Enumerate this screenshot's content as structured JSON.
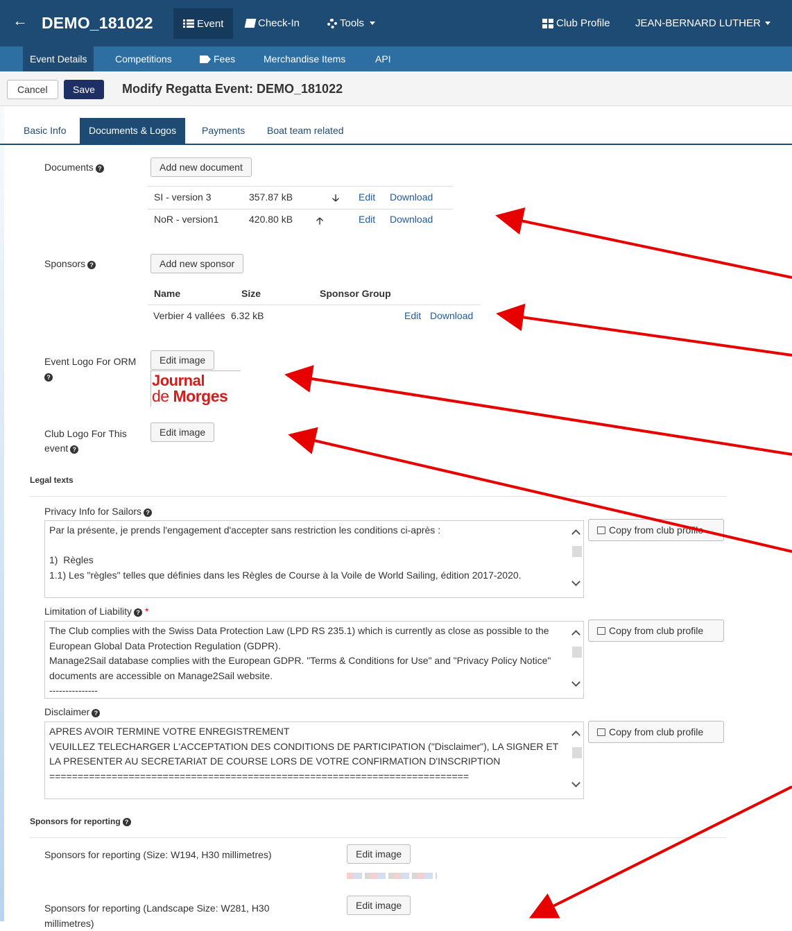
{
  "topbar": {
    "title": "DEMO_181022",
    "nav": {
      "event": "Event",
      "checkin": "Check-In",
      "tools": "Tools",
      "club_profile": "Club Profile",
      "user": "JEAN-BERNARD LUTHER"
    }
  },
  "subnav": {
    "event_details": "Event Details",
    "competitions": "Competitions",
    "fees": "Fees",
    "merchandise": "Merchandise Items",
    "api": "API"
  },
  "actions": {
    "cancel": "Cancel",
    "save": "Save",
    "page_title": "Modify Regatta Event: DEMO_181022"
  },
  "tabs": {
    "basic": "Basic Info",
    "documents": "Documents & Logos",
    "payments": "Payments",
    "boat": "Boat team related"
  },
  "documents": {
    "label": "Documents",
    "add_button": "Add new document",
    "rows": [
      {
        "name": "SI - version 3",
        "size": "357.87 kB",
        "edit": "Edit",
        "download": "Download"
      },
      {
        "name": "NoR - version1",
        "size": "420.80 kB",
        "edit": "Edit",
        "download": "Download"
      }
    ]
  },
  "sponsors": {
    "label": "Sponsors",
    "add_button": "Add new sponsor",
    "headers": {
      "name": "Name",
      "size": "Size",
      "group": "Sponsor Group"
    },
    "rows": [
      {
        "name": "Verbier 4 vallées",
        "size": "6.32 kB",
        "group": "",
        "edit": "Edit",
        "download": "Download"
      }
    ]
  },
  "event_logo": {
    "label": "Event Logo For ORM",
    "button": "Edit image",
    "logo_line1": "Journal",
    "logo_de": "de",
    "logo_line2": "Morges"
  },
  "club_logo": {
    "label_line1": "Club Logo For This",
    "label_line2": "event",
    "button": "Edit image"
  },
  "legal": {
    "heading": "Legal texts",
    "privacy": {
      "label": "Privacy Info for Sailors",
      "text": "Par la présente, je prends l'engagement d'accepter sans restriction les conditions ci-après :\n\n1)  Règles\n1.1) Les \"règles\" telles que définies dans les Règles de Course à la Voile de World Sailing, édition 2017-2020.",
      "copy_button": "Copy from club profile"
    },
    "liability": {
      "label": "Limitation of Liability",
      "required": "*",
      "text": "The Club complies with the Swiss Data Protection Law (LPD RS 235.1) which is currently as close as possible to the European Global Data Protection Regulation (GDPR).\nManage2Sail database complies with the European GDPR. \"Terms & Conditions for Use\" and \"Privacy Policy Notice\" documents are accessible on Manage2Sail website.\n---------------",
      "copy_button": "Copy from club profile"
    },
    "disclaimer": {
      "label": "Disclaimer",
      "text": "APRES AVOIR TERMINE VOTRE ENREGISTREMENT\nVEUILLEZ TELECHARGER L'ACCEPTATION DES CONDITIONS DE PARTICIPATION (\"Disclaimer\"), LA SIGNER ET LA PRESENTER AU SECRETARIAT DE COURSE LORS DE VOTRE CONFIRMATION D'INSCRIPTION\n==========================================================================",
      "copy_button": "Copy from club profile"
    }
  },
  "reporting": {
    "heading": "Sponsors for reporting",
    "item1": {
      "label": "Sponsors for reporting (Size: W194, H30 millimetres)",
      "button": "Edit image"
    },
    "item2": {
      "label_line1": "Sponsors for reporting (Landscape Size: W281, H30",
      "label_line2": "millimetres)",
      "button": "Edit image"
    }
  },
  "colors": {
    "nav_dark": "#1e4b74",
    "nav_sub": "#2d6ea3",
    "save_button": "#1e2f66",
    "annotation_arrow": "#e60000",
    "logo_red": "#d41c1c"
  },
  "icons": [
    "back-arrow-icon",
    "list-icon",
    "book-icon",
    "gear-icon",
    "grid-icon",
    "tag-icon",
    "help-icon",
    "arrow-down-icon",
    "arrow-up-icon",
    "edit-icon"
  ]
}
